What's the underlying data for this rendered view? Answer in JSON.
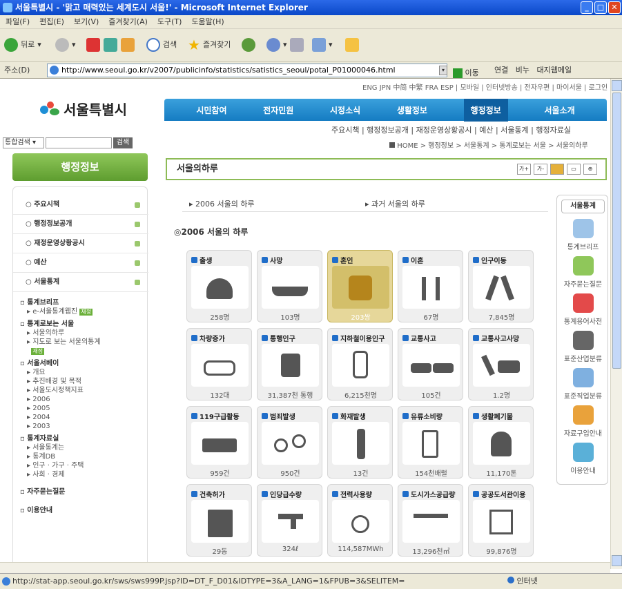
{
  "window": {
    "title": "서울특별시 - '맑고 매력있는 세계도시 서울!' - Microsoft Internet Explorer"
  },
  "menu": [
    "파일(F)",
    "편집(E)",
    "보기(V)",
    "즐겨찾기(A)",
    "도구(T)",
    "도움말(H)"
  ],
  "toolbar": {
    "back": "뒤로",
    "search": "검색",
    "favorites": "즐겨찾기"
  },
  "address": {
    "label": "주소(D)",
    "url": "http://www.seoul.go.kr/v2007/publicinfo/statistics/satistics_seoul/potal_P01000046.html",
    "go": "이동",
    "links": "연결",
    "link1": "비누",
    "link2": "대지웹메일"
  },
  "site": {
    "toplinks": "ENG JPN 中简 中繁 FRA ESP | 모바일 | 인터넷방송 | 전자우편 | 마이서울 | 로그인",
    "logo": "서울특별시",
    "gnb": [
      "시민참여",
      "전자민원",
      "시정소식",
      "생활정보",
      "행정정보",
      "서울소개"
    ],
    "subnav": "주요시책 | 행정정보공개 | 재정운영상황공시 | 예산 | 서울통계 | 행정자료실",
    "search_select": "통합검색",
    "search_button": "검색",
    "breadcrumb": "HOME > 행정정보 > 서울통계 > 통계로보는 서울 > 서울의하루"
  },
  "lnb": {
    "title": "행정정보",
    "menus": [
      "주요시책",
      "행정정보공개",
      "재정운영상황공시",
      "예산",
      "서울통계"
    ],
    "sub1_head": "통계브리프",
    "sub1_items": [
      "e-서울통계웹진"
    ],
    "sub2_head": "통계로보는 서울",
    "sub2_items": [
      "서울의하루",
      "지도로 보는 서울의통계"
    ],
    "sub3_head": "서울서베이",
    "sub3_items": [
      "개요",
      "추진배경 및 목적",
      "서울도시정책지표",
      "2006",
      "2005",
      "2004",
      "2003"
    ],
    "sub4_head": "통계자료실",
    "sub4_items": [
      "서울통계는",
      "통계DB",
      "인구 · 가구 · 주택",
      "사회 · 경제"
    ],
    "sub5_head": "자주묻는질문",
    "sub6_head": "이용안내",
    "badge": "재정"
  },
  "content": {
    "title": "서울의하루",
    "tools": [
      "가+",
      "가-"
    ],
    "tabs": [
      "▸ 2006 서울의 하루",
      "▸ 과거 서울의 하루"
    ],
    "section_title": "◎2006 서울의 하루"
  },
  "cards": [
    {
      "label": "출생",
      "value": "258명"
    },
    {
      "label": "사망",
      "value": "103명"
    },
    {
      "label": "혼인",
      "value": "203쌍"
    },
    {
      "label": "이혼",
      "value": "67명"
    },
    {
      "label": "인구이동",
      "value": "7,845명"
    },
    {
      "label": "차량증가",
      "value": "132대"
    },
    {
      "label": "통행인구",
      "value": "31,387천 통행"
    },
    {
      "label": "지하철이용인구",
      "value": "6,215천명"
    },
    {
      "label": "교통사고",
      "value": "105건"
    },
    {
      "label": "교통사고사망",
      "value": "1.2명"
    },
    {
      "label": "119구급활동",
      "value": "959건"
    },
    {
      "label": "범죄발생",
      "value": "950건"
    },
    {
      "label": "화재발생",
      "value": "13건"
    },
    {
      "label": "유류소비량",
      "value": "154천배럴"
    },
    {
      "label": "생활폐기물",
      "value": "11,170톤"
    },
    {
      "label": "건축허가",
      "value": "29동"
    },
    {
      "label": "인당급수량",
      "value": "324ℓ"
    },
    {
      "label": "전력사용량",
      "value": "114,587MWh"
    },
    {
      "label": "도시가스공급량",
      "value": "13,296천㎥"
    },
    {
      "label": "공공도서관이용",
      "value": "99,876명"
    }
  ],
  "rstat": {
    "head": "서울통계",
    "items": [
      "통계브리프",
      "자주묻는질문",
      "통계용어사전",
      "표준산업분류",
      "표준직업분류",
      "자료구입안내",
      "이용안내"
    ]
  },
  "status": {
    "url": "http://stat-app.seoul.go.kr/sws/sws999P.jsp?ID=DT_F_D01&IDTYPE=3&A_LANG=1&FPUB=3&SELITEM=",
    "zone": "인터넷"
  }
}
